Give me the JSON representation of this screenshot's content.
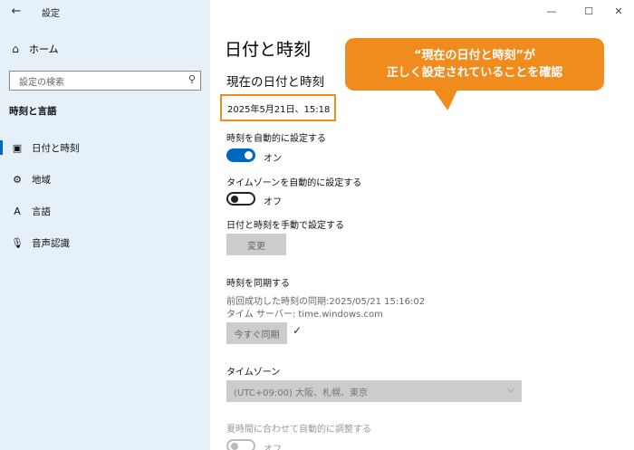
{
  "window": {
    "title": "設定",
    "back_glyph": "←",
    "minimize_glyph": "—",
    "maximize_glyph": "☐",
    "close_glyph": "✕"
  },
  "sidebar": {
    "home_label": "ホーム",
    "home_icon": "⌂",
    "search": {
      "placeholder": "設定の検索",
      "icon": "⚲"
    },
    "section_title": "時刻と言語",
    "items": [
      {
        "label": "日付と時刻",
        "icon": "▣",
        "active": true
      },
      {
        "label": "地域",
        "icon": "⚙"
      },
      {
        "label": "言語",
        "icon": "A"
      },
      {
        "label": "音声認識",
        "icon": "🎙"
      }
    ]
  },
  "main": {
    "title": "日付と時刻",
    "current_heading": "現在の日付と時刻",
    "current_datetime": "2025年5月21日、15:18",
    "auto_time": {
      "label": "時刻を自動的に設定する",
      "state": "オン"
    },
    "auto_timezone": {
      "label": "タイムゾーンを自動的に設定する",
      "state": "オフ"
    },
    "manual": {
      "label": "日付と時刻を手動で設定する",
      "button": "変更"
    },
    "sync": {
      "heading": "時刻を同期する",
      "last_sync": "前回成功した時刻の同期:2025/05/21 15:16:02",
      "server": "タイム サーバー: time.windows.com",
      "button": "今すぐ同期",
      "check": "✓"
    },
    "timezone": {
      "label": "タイムゾーン",
      "value": "(UTC+09:00) 大阪、札幌、東京",
      "chevron": "⌵"
    },
    "dst": {
      "label": "夏時間に合わせて自動的に調整する",
      "state": "オフ"
    }
  },
  "callout": {
    "line1": "“現在の日付と時刻”が",
    "line2": "正しく設定されていることを確認"
  },
  "colors": {
    "accent": "#0067c0",
    "callout": "#f08c1e",
    "sidebar_bg": "#e6f0f9"
  }
}
